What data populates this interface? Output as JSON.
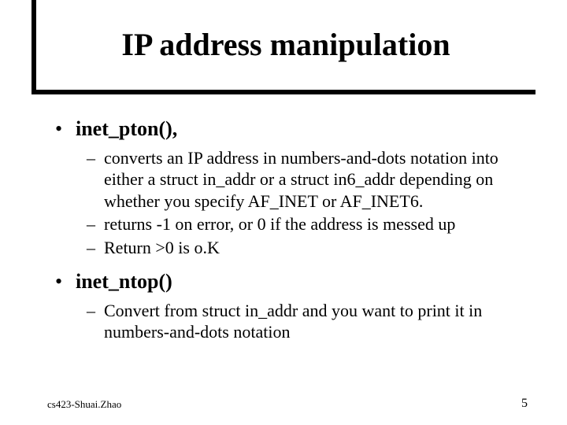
{
  "title": "IP address manipulation",
  "bullets": [
    {
      "label": "inet_pton(),",
      "subs": [
        "converts an IP address in numbers-and-dots notation into either a struct in_addr or a struct in6_addr depending on whether you specify AF_INET or AF_INET6.",
        "returns -1 on error, or 0 if the address is messed up",
        "Return >0 is o.K"
      ]
    },
    {
      "label": "inet_ntop()",
      "subs": [
        "Convert from struct in_addr and you want to print it in numbers-and-dots notation"
      ]
    }
  ],
  "footer": {
    "left": "cs423-Shuai.Zhao",
    "page": "5"
  }
}
